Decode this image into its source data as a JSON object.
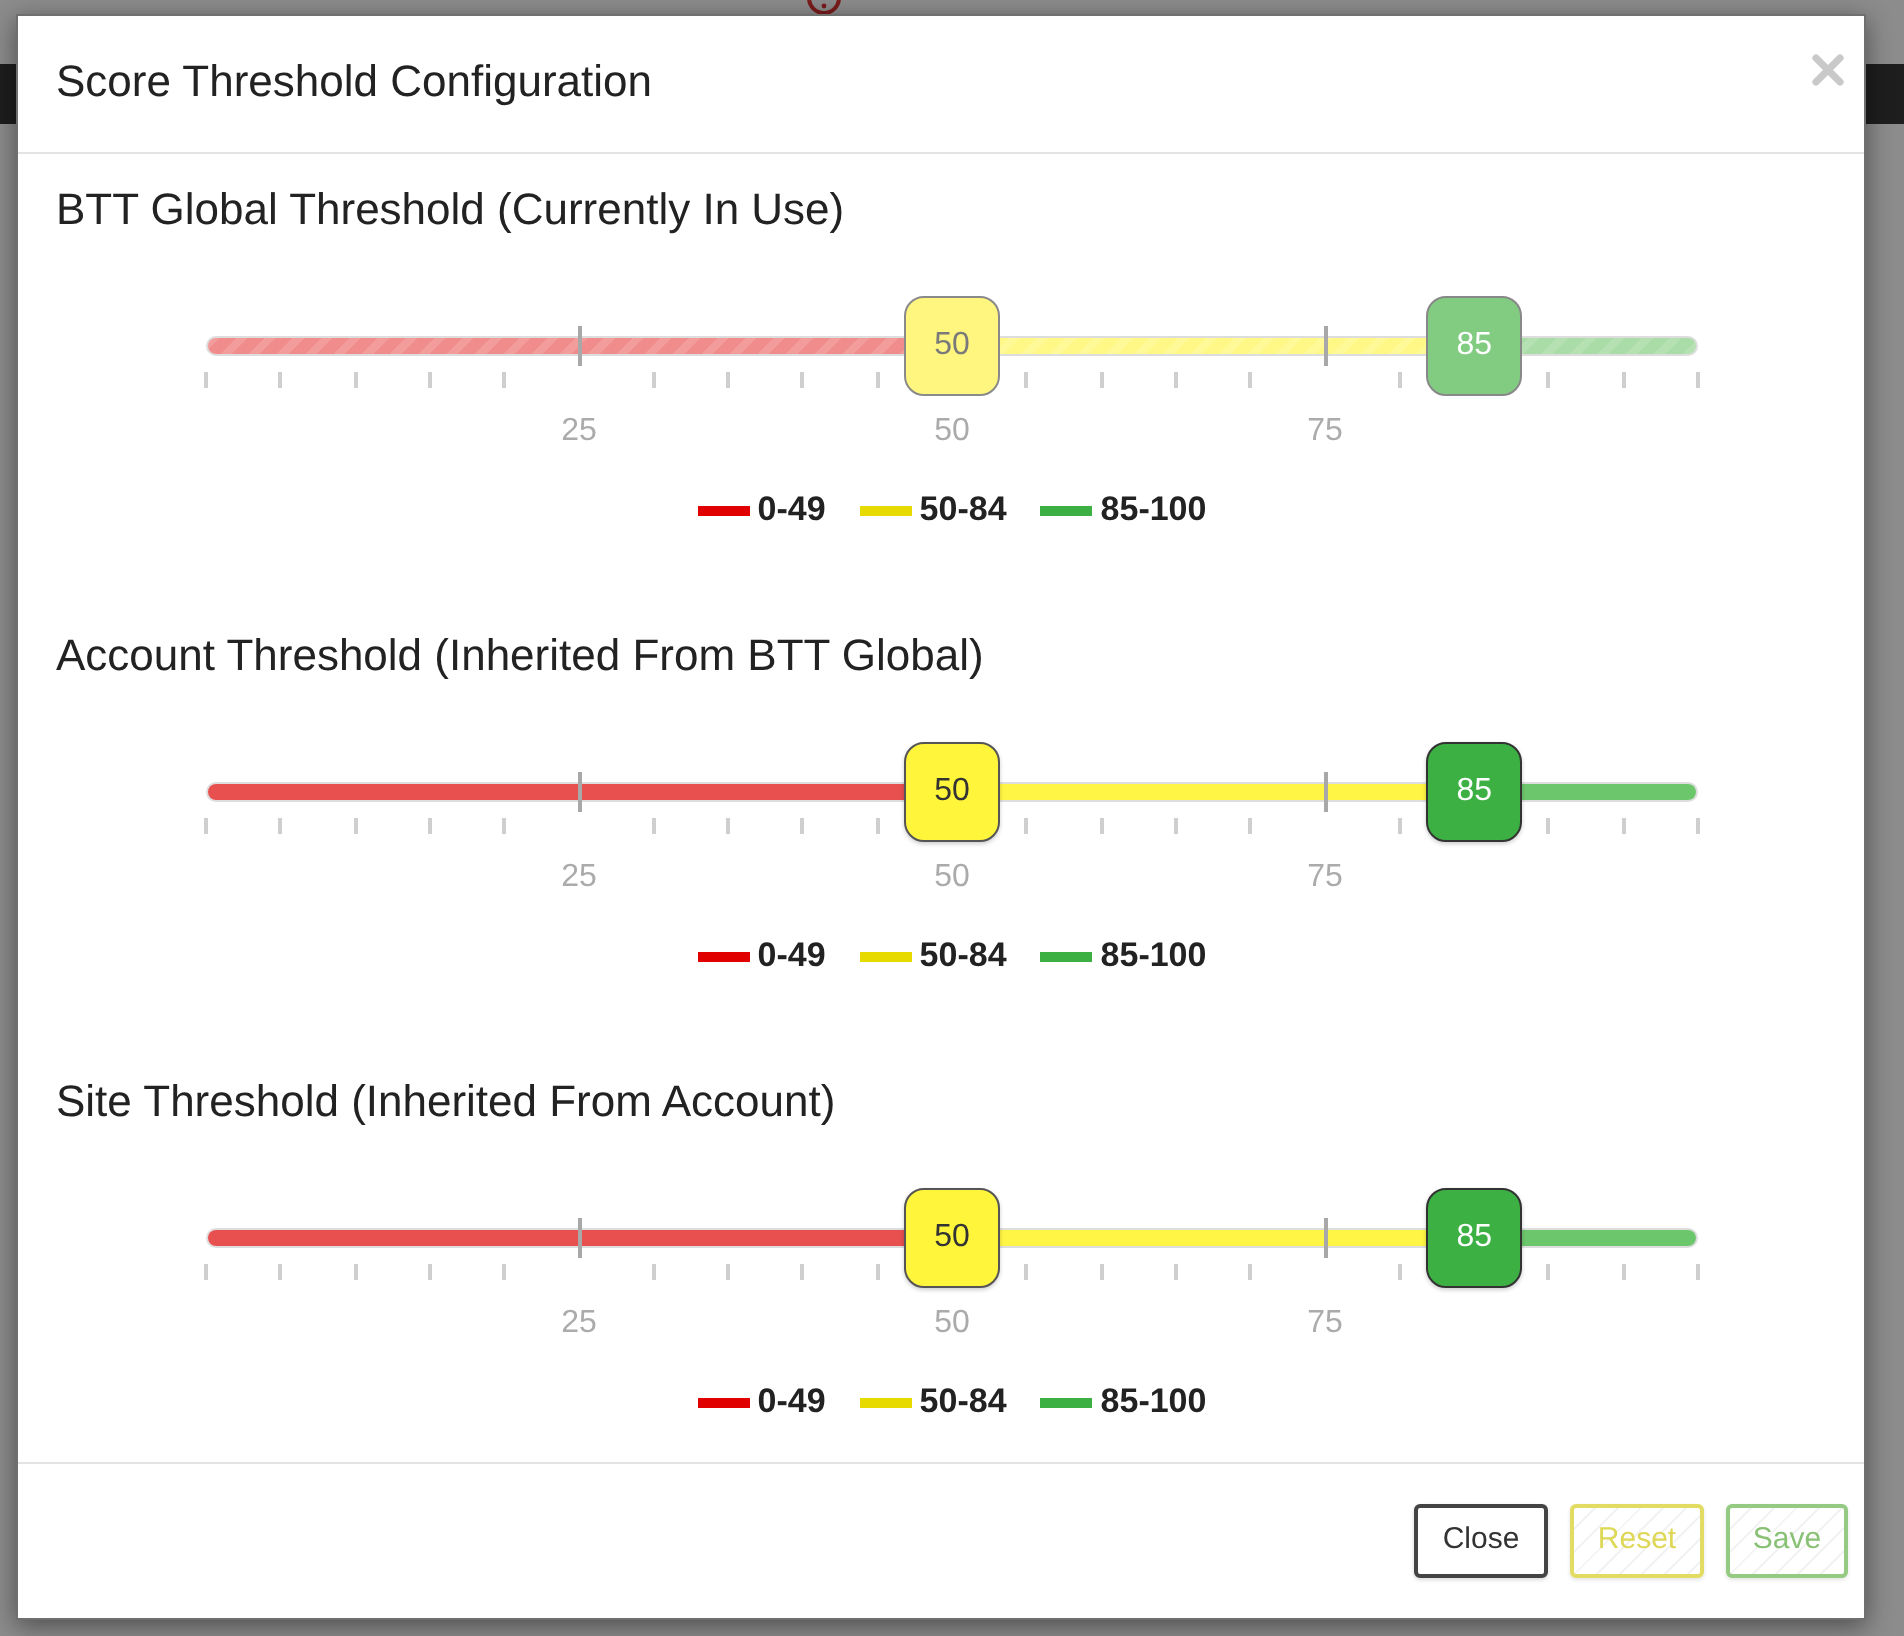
{
  "dialog": {
    "title": "Score Threshold Configuration",
    "sections": [
      {
        "title": "BTT Global Threshold (Currently In Use)",
        "disabled": true,
        "handles": [
          {
            "label": "50",
            "level": 0.5
          },
          {
            "label": "85",
            "level": 0.85
          }
        ],
        "tick_labels": [
          "25",
          "50",
          "75"
        ],
        "legend": [
          {
            "label": "0-49",
            "color": "#e00000"
          },
          {
            "label": "50-84",
            "color": "#e6da00"
          },
          {
            "label": "85-100",
            "color": "#3cb043"
          }
        ]
      },
      {
        "title": "Account Threshold (Inherited From BTT Global)",
        "disabled": false,
        "handles": [
          {
            "label": "50",
            "level": 0.5
          },
          {
            "label": "85",
            "level": 0.85
          }
        ],
        "tick_labels": [
          "25",
          "50",
          "75"
        ],
        "legend": [
          {
            "label": "0-49",
            "color": "#e00000"
          },
          {
            "label": "50-84",
            "color": "#e6da00"
          },
          {
            "label": "85-100",
            "color": "#3cb043"
          }
        ]
      },
      {
        "title": "Site Threshold (Inherited From Account)",
        "disabled": false,
        "handles": [
          {
            "label": "50",
            "level": 0.5
          },
          {
            "label": "85",
            "level": 0.85
          }
        ],
        "tick_labels": [
          "25",
          "50",
          "75"
        ],
        "legend": [
          {
            "label": "0-49",
            "color": "#e00000"
          },
          {
            "label": "50-84",
            "color": "#e6da00"
          },
          {
            "label": "85-100",
            "color": "#3cb043"
          }
        ]
      }
    ],
    "buttons": [
      {
        "label": "Close",
        "kind": "default",
        "disabled": false
      },
      {
        "label": "Reset",
        "kind": "warning",
        "disabled": true
      },
      {
        "label": "Save",
        "kind": "success",
        "disabled": true
      }
    ]
  }
}
